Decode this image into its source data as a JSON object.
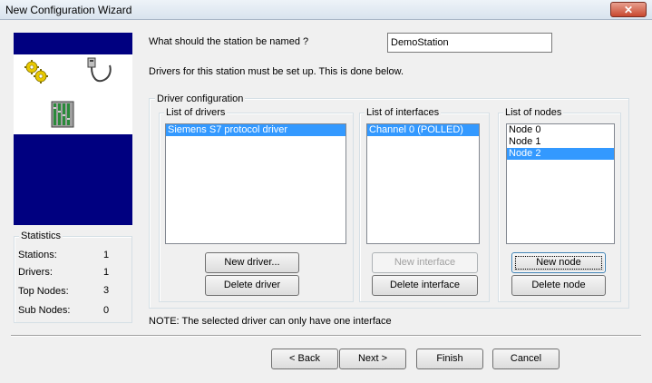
{
  "window": {
    "title": "New Configuration Wizard",
    "close_glyph": "✕"
  },
  "station": {
    "prompt": "What should the station be named ?",
    "name_value": "DemoStation",
    "drivers_info": "Drivers for this station must be set up. This is done below."
  },
  "driver_config": {
    "title": "Driver configuration",
    "drivers": {
      "title": "List of drivers",
      "items": [
        {
          "label": "Siemens S7 protocol driver",
          "selected": true
        }
      ],
      "new_label": "New driver...",
      "delete_label": "Delete driver"
    },
    "interfaces": {
      "title": "List of interfaces",
      "items": [
        {
          "label": "Channel 0 (POLLED)",
          "selected": true
        }
      ],
      "new_label": "New interface",
      "delete_label": "Delete interface"
    },
    "nodes": {
      "title": "List of nodes",
      "items": [
        {
          "label": "Node 0",
          "selected": false
        },
        {
          "label": "Node 1",
          "selected": false
        },
        {
          "label": "Node 2",
          "selected": true
        }
      ],
      "new_label": "New node",
      "delete_label": "Delete node"
    }
  },
  "note": "NOTE: The selected driver can only have one interface",
  "statistics": {
    "title": "Statistics",
    "rows": [
      {
        "label": "Stations:",
        "value": "1"
      },
      {
        "label": "Drivers:",
        "value": "1"
      },
      {
        "label": "Top Nodes:",
        "value": "3"
      },
      {
        "label": "Sub Nodes:",
        "value": "0"
      }
    ]
  },
  "footer": {
    "back_label": "< Back",
    "next_label": "Next >",
    "finish_label": "Finish",
    "cancel_label": "Cancel"
  },
  "colors": {
    "selection": "#3399ff",
    "banner": "#000080"
  }
}
